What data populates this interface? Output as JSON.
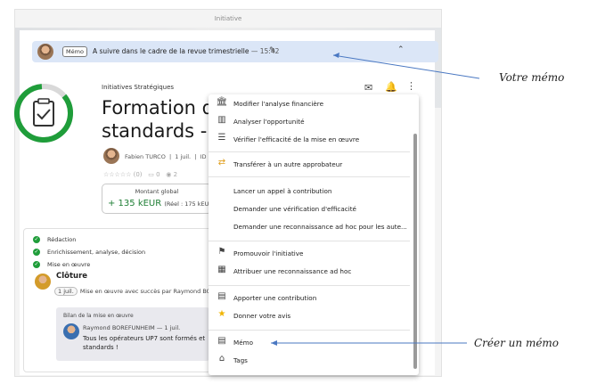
{
  "window": {
    "title": "Initiative"
  },
  "memo_bar": {
    "tag": "Mémo",
    "text": "A suivre dans le cadre de la revue trimestrielle",
    "time": "— 15:42"
  },
  "initiative": {
    "category": "Initiatives Stratégiques",
    "title_line1": "Formation des",
    "title_line2": "standards - Lig",
    "author": "Fabien TURCO",
    "date": "1 juil.",
    "id_prefix": "ID",
    "rating_count": "(0)",
    "comments": "0",
    "views": "2"
  },
  "amount": {
    "label": "Montant global",
    "value": "+ 135 kEUR",
    "real": "(Réel : 175 kEUR)"
  },
  "timeline": {
    "steps": [
      "Rédaction",
      "Enrichissement, analyse, décision",
      "Mise en œuvre"
    ],
    "closure": "Clôture",
    "closure_chip": "1 juil.",
    "closure_text": "Mise en œuvre avec succès par Raymond BO",
    "bilan_title": "Bilan de la mise en œuvre",
    "bilan_author": "Raymond BOREFUNHEIM — 1 juil.",
    "bilan_text": "Tous les opérateurs UP7 sont formés et standards !"
  },
  "menu": {
    "items": [
      {
        "label": "Modifier l'analyse financière",
        "icon": "bank-icon"
      },
      {
        "label": "Analyser l'opportunité",
        "icon": "chart-icon"
      },
      {
        "label": "Vérifier l'efficacité de la mise en œuvre",
        "icon": "checklist-icon"
      },
      {
        "label": "Transférer à un autre approbateur",
        "icon": "transfer-icon"
      },
      {
        "label": "Lancer un appel à contribution",
        "icon": ""
      },
      {
        "label": "Demander une vérification d'efficacité",
        "icon": ""
      },
      {
        "label": "Demander une reconnaissance ad hoc pour les aute...",
        "icon": ""
      },
      {
        "label": "Promouvoir l'initiative",
        "icon": "flag-icon"
      },
      {
        "label": "Attribuer une reconnaissance ad hoc",
        "icon": "award-icon"
      },
      {
        "label": "Apporter une contribution",
        "icon": "contribution-icon"
      },
      {
        "label": "Donner votre avis",
        "icon": "star-icon"
      },
      {
        "label": "Mémo",
        "icon": "memo-icon"
      },
      {
        "label": "Tags",
        "icon": "tag-icon"
      }
    ]
  },
  "annotations": {
    "memo_callout": "Votre mémo",
    "create_callout": "Créer un mémo"
  },
  "colors": {
    "memo_bar": "#dbe6f7",
    "accent_green": "#1f9d3a",
    "amount_green": "#1e7e34"
  }
}
